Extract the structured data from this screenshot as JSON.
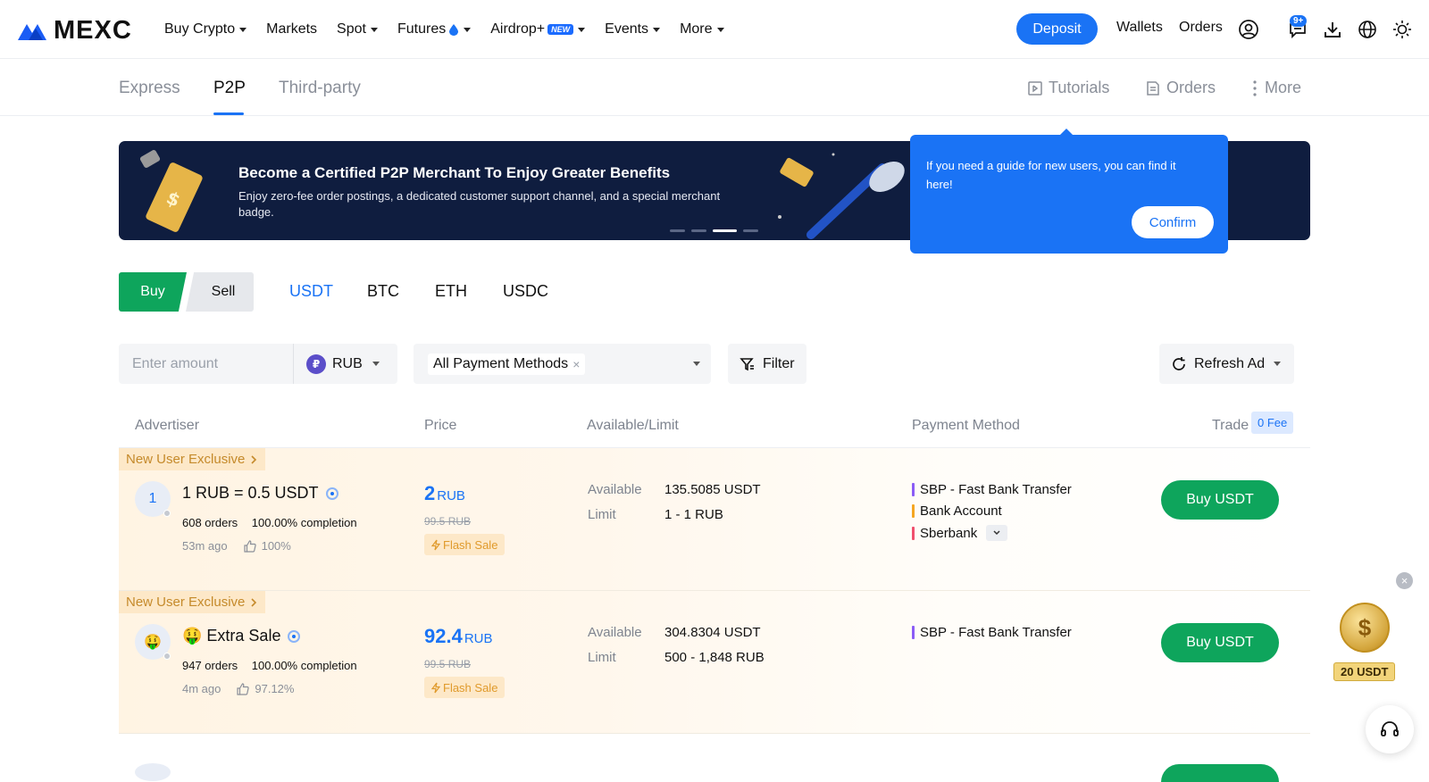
{
  "header": {
    "logo_text": "MEXC",
    "nav": [
      {
        "label": "Buy Crypto",
        "caret": true
      },
      {
        "label": "Markets",
        "caret": false
      },
      {
        "label": "Spot",
        "caret": true
      },
      {
        "label": "Futures",
        "caret": true
      },
      {
        "label": "Airdrop+",
        "caret": true,
        "badge": "NEW"
      },
      {
        "label": "Events",
        "caret": true
      },
      {
        "label": "More",
        "caret": true
      }
    ],
    "deposit_label": "Deposit",
    "wallets_label": "Wallets",
    "orders_label": "Orders",
    "notification_badge": "9+"
  },
  "subnav": {
    "tabs": [
      "Express",
      "P2P",
      "Third-party"
    ],
    "active_tab": "P2P",
    "right": {
      "tutorials": "Tutorials",
      "orders": "Orders",
      "more": "More"
    }
  },
  "banner": {
    "title": "Become a Certified P2P Merchant To Enjoy Greater Benefits",
    "subtitle": "Enjoy zero-fee order postings, a dedicated customer support channel, and a special merchant badge.",
    "dots": 4,
    "active_dot": 2
  },
  "tooltip": {
    "text": "If you need a guide for new users, you can find it here!",
    "confirm_label": "Confirm"
  },
  "trade": {
    "buy_label": "Buy",
    "sell_label": "Sell",
    "coins": [
      "USDT",
      "BTC",
      "ETH",
      "USDC"
    ],
    "active_coin": "USDT"
  },
  "filters": {
    "amount_placeholder": "Enter amount",
    "currency_symbol": "₽",
    "currency": "RUB",
    "payment_methods": "All Payment Methods",
    "filter_label": "Filter",
    "refresh_label": "Refresh Ad"
  },
  "table": {
    "headers": {
      "advertiser": "Advertiser",
      "price": "Price",
      "available_limit": "Available/Limit",
      "payment_method": "Payment Method",
      "trade": "Trade"
    },
    "fee_badge": "0 Fee",
    "rows": [
      {
        "tag": "New User Exclusive",
        "avatar": "1",
        "name": "1 RUB = 0.5 USDT",
        "orders": "608 orders",
        "completion": "100.00% completion",
        "time": "53m ago",
        "rating": "100%",
        "price": "2",
        "price_unit": "RUB",
        "old_price": "99.5 RUB",
        "flash": "Flash Sale",
        "available_label": "Available",
        "available": "135.5085 USDT",
        "limit_label": "Limit",
        "limit": "1 - 1 RUB",
        "payment_methods": [
          {
            "name": "SBP - Fast Bank Transfer",
            "color": "#8b5cf6"
          },
          {
            "name": "Bank Account",
            "color": "#f5a623"
          },
          {
            "name": "Sberbank",
            "color": "#f0506e"
          }
        ],
        "button": "Buy USDT"
      },
      {
        "tag": "New User Exclusive",
        "avatar": "🤑",
        "name": "🤑 Extra Sale",
        "orders": "947 orders",
        "completion": "100.00% completion",
        "time": "4m ago",
        "rating": "97.12%",
        "price": "92.4",
        "price_unit": "RUB",
        "old_price": "99.5 RUB",
        "flash": "Flash Sale",
        "available_label": "Available",
        "available": "304.8304 USDT",
        "limit_label": "Limit",
        "limit": "500 - 1,848 RUB",
        "payment_methods": [
          {
            "name": "SBP - Fast Bank Transfer",
            "color": "#8b5cf6"
          }
        ],
        "button": "Buy USDT"
      }
    ]
  },
  "floating": {
    "reward": "20 USDT"
  },
  "colors": {
    "accent": "#1a73f5",
    "buy_green": "#0ea55c",
    "banner_bg": "#0f1d3f",
    "exclusive_orange": "#c58a2b"
  }
}
